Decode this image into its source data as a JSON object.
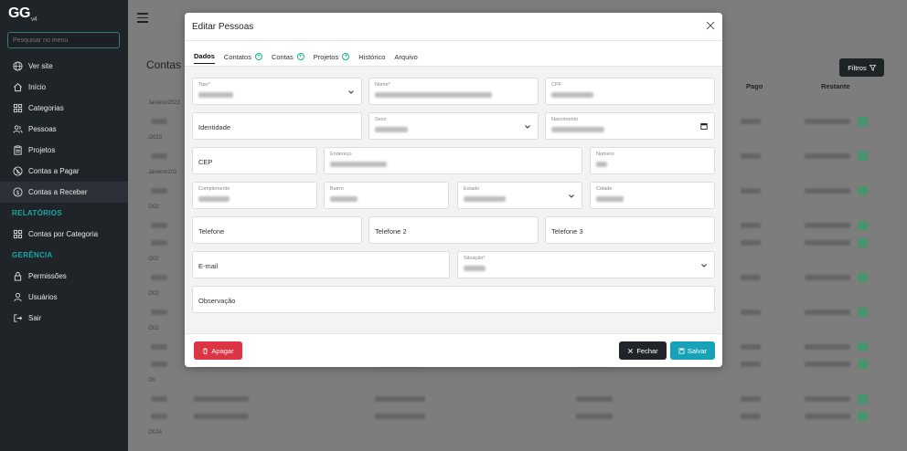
{
  "brand": {
    "name": "GG",
    "sub": "v4"
  },
  "sidebar": {
    "search_placeholder": "Pesquisar no menu",
    "items": [
      {
        "label": "Ver site",
        "icon": "globe-icon"
      },
      {
        "label": "Início",
        "icon": "home-icon"
      },
      {
        "label": "Categorias",
        "icon": "grid-icon"
      },
      {
        "label": "Pessoas",
        "icon": "users-icon"
      },
      {
        "label": "Projetos",
        "icon": "clipboard-icon"
      },
      {
        "label": "Contas a Pagar",
        "icon": "no-money-icon"
      },
      {
        "label": "Contas a Receber",
        "icon": "dollar-icon",
        "active": true
      }
    ],
    "section_reports": "RELATÓRIOS",
    "report_items": [
      {
        "label": "Contas por Categoria",
        "icon": "grid-icon"
      }
    ],
    "section_manage": "GERÊNCIA",
    "manage_items": [
      {
        "label": "Permissões",
        "icon": "lock-icon"
      },
      {
        "label": "Usuários",
        "icon": "user-icon"
      },
      {
        "label": "Sair",
        "icon": "logout-icon"
      }
    ]
  },
  "main": {
    "title": "Contas a",
    "filter_label": "Filtros",
    "columns": {
      "pago": "Pago",
      "restante": "Restante"
    },
    "groups": [
      "Janeiro/2023",
      "/2023",
      "Janeiro/202",
      "/202",
      "/202",
      "/202",
      "/202",
      "/20",
      "/2024"
    ]
  },
  "modal": {
    "title": "Editar Pessoas",
    "tabs": [
      {
        "label": "Dados",
        "active": true
      },
      {
        "label": "Contatos",
        "plus": true
      },
      {
        "label": "Contas",
        "plus": true
      },
      {
        "label": "Projetos",
        "plus": true
      },
      {
        "label": "Histórico"
      },
      {
        "label": "Arquivo"
      }
    ],
    "fields": {
      "tipo": "Tipo*",
      "nome": "Nome*",
      "cpf": "CPF",
      "identidade": "Identidade",
      "sexo": "Sexo",
      "nascimento": "Nascimento",
      "cep": "CEP",
      "endereco": "Endereço",
      "numero": "Número",
      "complemento": "Complemento",
      "bairro": "Bairro",
      "estado": "Estado",
      "cidade": "Cidade",
      "telefone": "Telefone",
      "telefone2": "Telefone 2",
      "telefone3": "Telefone 3",
      "email": "E-mail",
      "situacao": "Situação*",
      "observacao": "Observação"
    },
    "buttons": {
      "apagar": "Apagar",
      "fechar": "Fechar",
      "salvar": "Salvar"
    }
  }
}
